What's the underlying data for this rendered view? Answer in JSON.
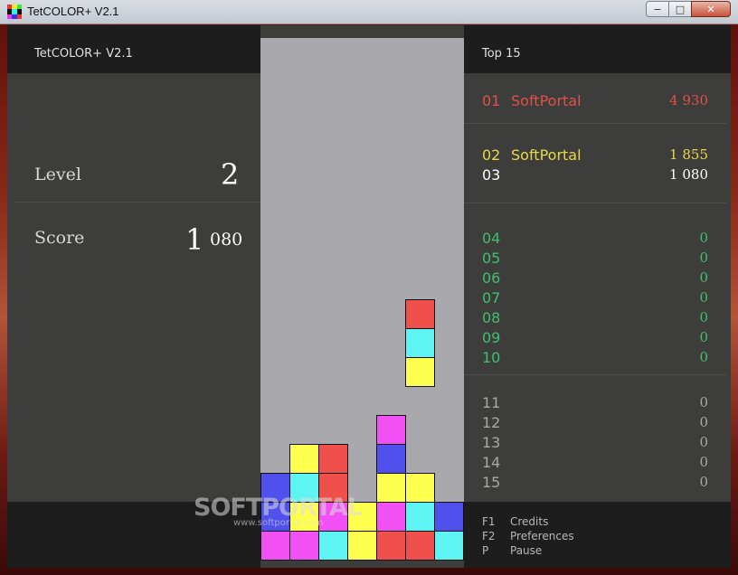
{
  "window": {
    "title": "TetCOLOR+ V2.1",
    "buttons": [
      "−",
      "□",
      "✕"
    ]
  },
  "app": {
    "title": "TetCOLOR+ V2.1"
  },
  "stats": {
    "level_label": "Level",
    "level_value": "2",
    "score_label": "Score",
    "score_big": "1",
    "score_rest": "080"
  },
  "top": {
    "title": "Top 15",
    "entries": [
      {
        "rank": "01",
        "name": "SoftPortal",
        "points": "4 930",
        "color": "#e2504a"
      },
      {
        "rank": "02",
        "name": "SoftPortal",
        "points": "1 855",
        "color": "#e8d84a"
      },
      {
        "rank": "03",
        "name": "",
        "points": "1 080",
        "color": "#ffffff"
      },
      {
        "rank": "04",
        "name": "",
        "points": "0",
        "color": "#3fbf72"
      },
      {
        "rank": "05",
        "name": "",
        "points": "0",
        "color": "#3fbf72"
      },
      {
        "rank": "06",
        "name": "",
        "points": "0",
        "color": "#3fbf72"
      },
      {
        "rank": "07",
        "name": "",
        "points": "0",
        "color": "#3fbf72"
      },
      {
        "rank": "08",
        "name": "",
        "points": "0",
        "color": "#3fbf72"
      },
      {
        "rank": "09",
        "name": "",
        "points": "0",
        "color": "#3fbf72"
      },
      {
        "rank": "10",
        "name": "",
        "points": "0",
        "color": "#3fbf72"
      },
      {
        "rank": "11",
        "name": "",
        "points": "0",
        "color": "#a8a8a8"
      },
      {
        "rank": "12",
        "name": "",
        "points": "0",
        "color": "#a8a8a8"
      },
      {
        "rank": "13",
        "name": "",
        "points": "0",
        "color": "#a8a8a8"
      },
      {
        "rank": "14",
        "name": "",
        "points": "0",
        "color": "#a8a8a8"
      },
      {
        "rank": "15",
        "name": "",
        "points": "0",
        "color": "#a8a8a8"
      }
    ]
  },
  "keys": [
    {
      "key": "F1",
      "desc": "Credits"
    },
    {
      "key": "F2",
      "desc": "Preferences"
    },
    {
      "key": "P",
      "desc": "Pause"
    }
  ],
  "colors": {
    "red": "#f0504c",
    "cyan": "#5ff4f4",
    "yellow": "#ffff50",
    "magenta": "#f050f4",
    "blue": "#5050ec"
  },
  "board": {
    "columns": 7,
    "rows": 18,
    "falling_piece": [
      {
        "col": 5,
        "row": 9,
        "color": "red"
      },
      {
        "col": 5,
        "row": 10,
        "color": "cyan"
      },
      {
        "col": 5,
        "row": 11,
        "color": "yellow"
      }
    ],
    "stack": [
      {
        "col": 4,
        "row": 13,
        "color": "magenta"
      },
      {
        "col": 1,
        "row": 14,
        "color": "yellow"
      },
      {
        "col": 2,
        "row": 14,
        "color": "red"
      },
      {
        "col": 4,
        "row": 14,
        "color": "blue"
      },
      {
        "col": 0,
        "row": 15,
        "color": "blue"
      },
      {
        "col": 1,
        "row": 15,
        "color": "cyan"
      },
      {
        "col": 2,
        "row": 15,
        "color": "red"
      },
      {
        "col": 4,
        "row": 15,
        "color": "yellow"
      },
      {
        "col": 5,
        "row": 15,
        "color": "yellow"
      },
      {
        "col": 0,
        "row": 16,
        "color": "blue"
      },
      {
        "col": 1,
        "row": 16,
        "color": "yellow"
      },
      {
        "col": 2,
        "row": 16,
        "color": "magenta"
      },
      {
        "col": 3,
        "row": 16,
        "color": "yellow"
      },
      {
        "col": 4,
        "row": 16,
        "color": "magenta"
      },
      {
        "col": 5,
        "row": 16,
        "color": "cyan"
      },
      {
        "col": 6,
        "row": 16,
        "color": "blue"
      },
      {
        "col": 0,
        "row": 17,
        "color": "magenta"
      },
      {
        "col": 1,
        "row": 17,
        "color": "magenta"
      },
      {
        "col": 2,
        "row": 17,
        "color": "cyan"
      },
      {
        "col": 3,
        "row": 17,
        "color": "yellow"
      },
      {
        "col": 4,
        "row": 17,
        "color": "red"
      },
      {
        "col": 5,
        "row": 17,
        "color": "red"
      },
      {
        "col": 6,
        "row": 17,
        "color": "cyan"
      }
    ]
  },
  "watermark": {
    "logo": "SOFTPORTAL",
    "url": "www.softportal.com"
  }
}
